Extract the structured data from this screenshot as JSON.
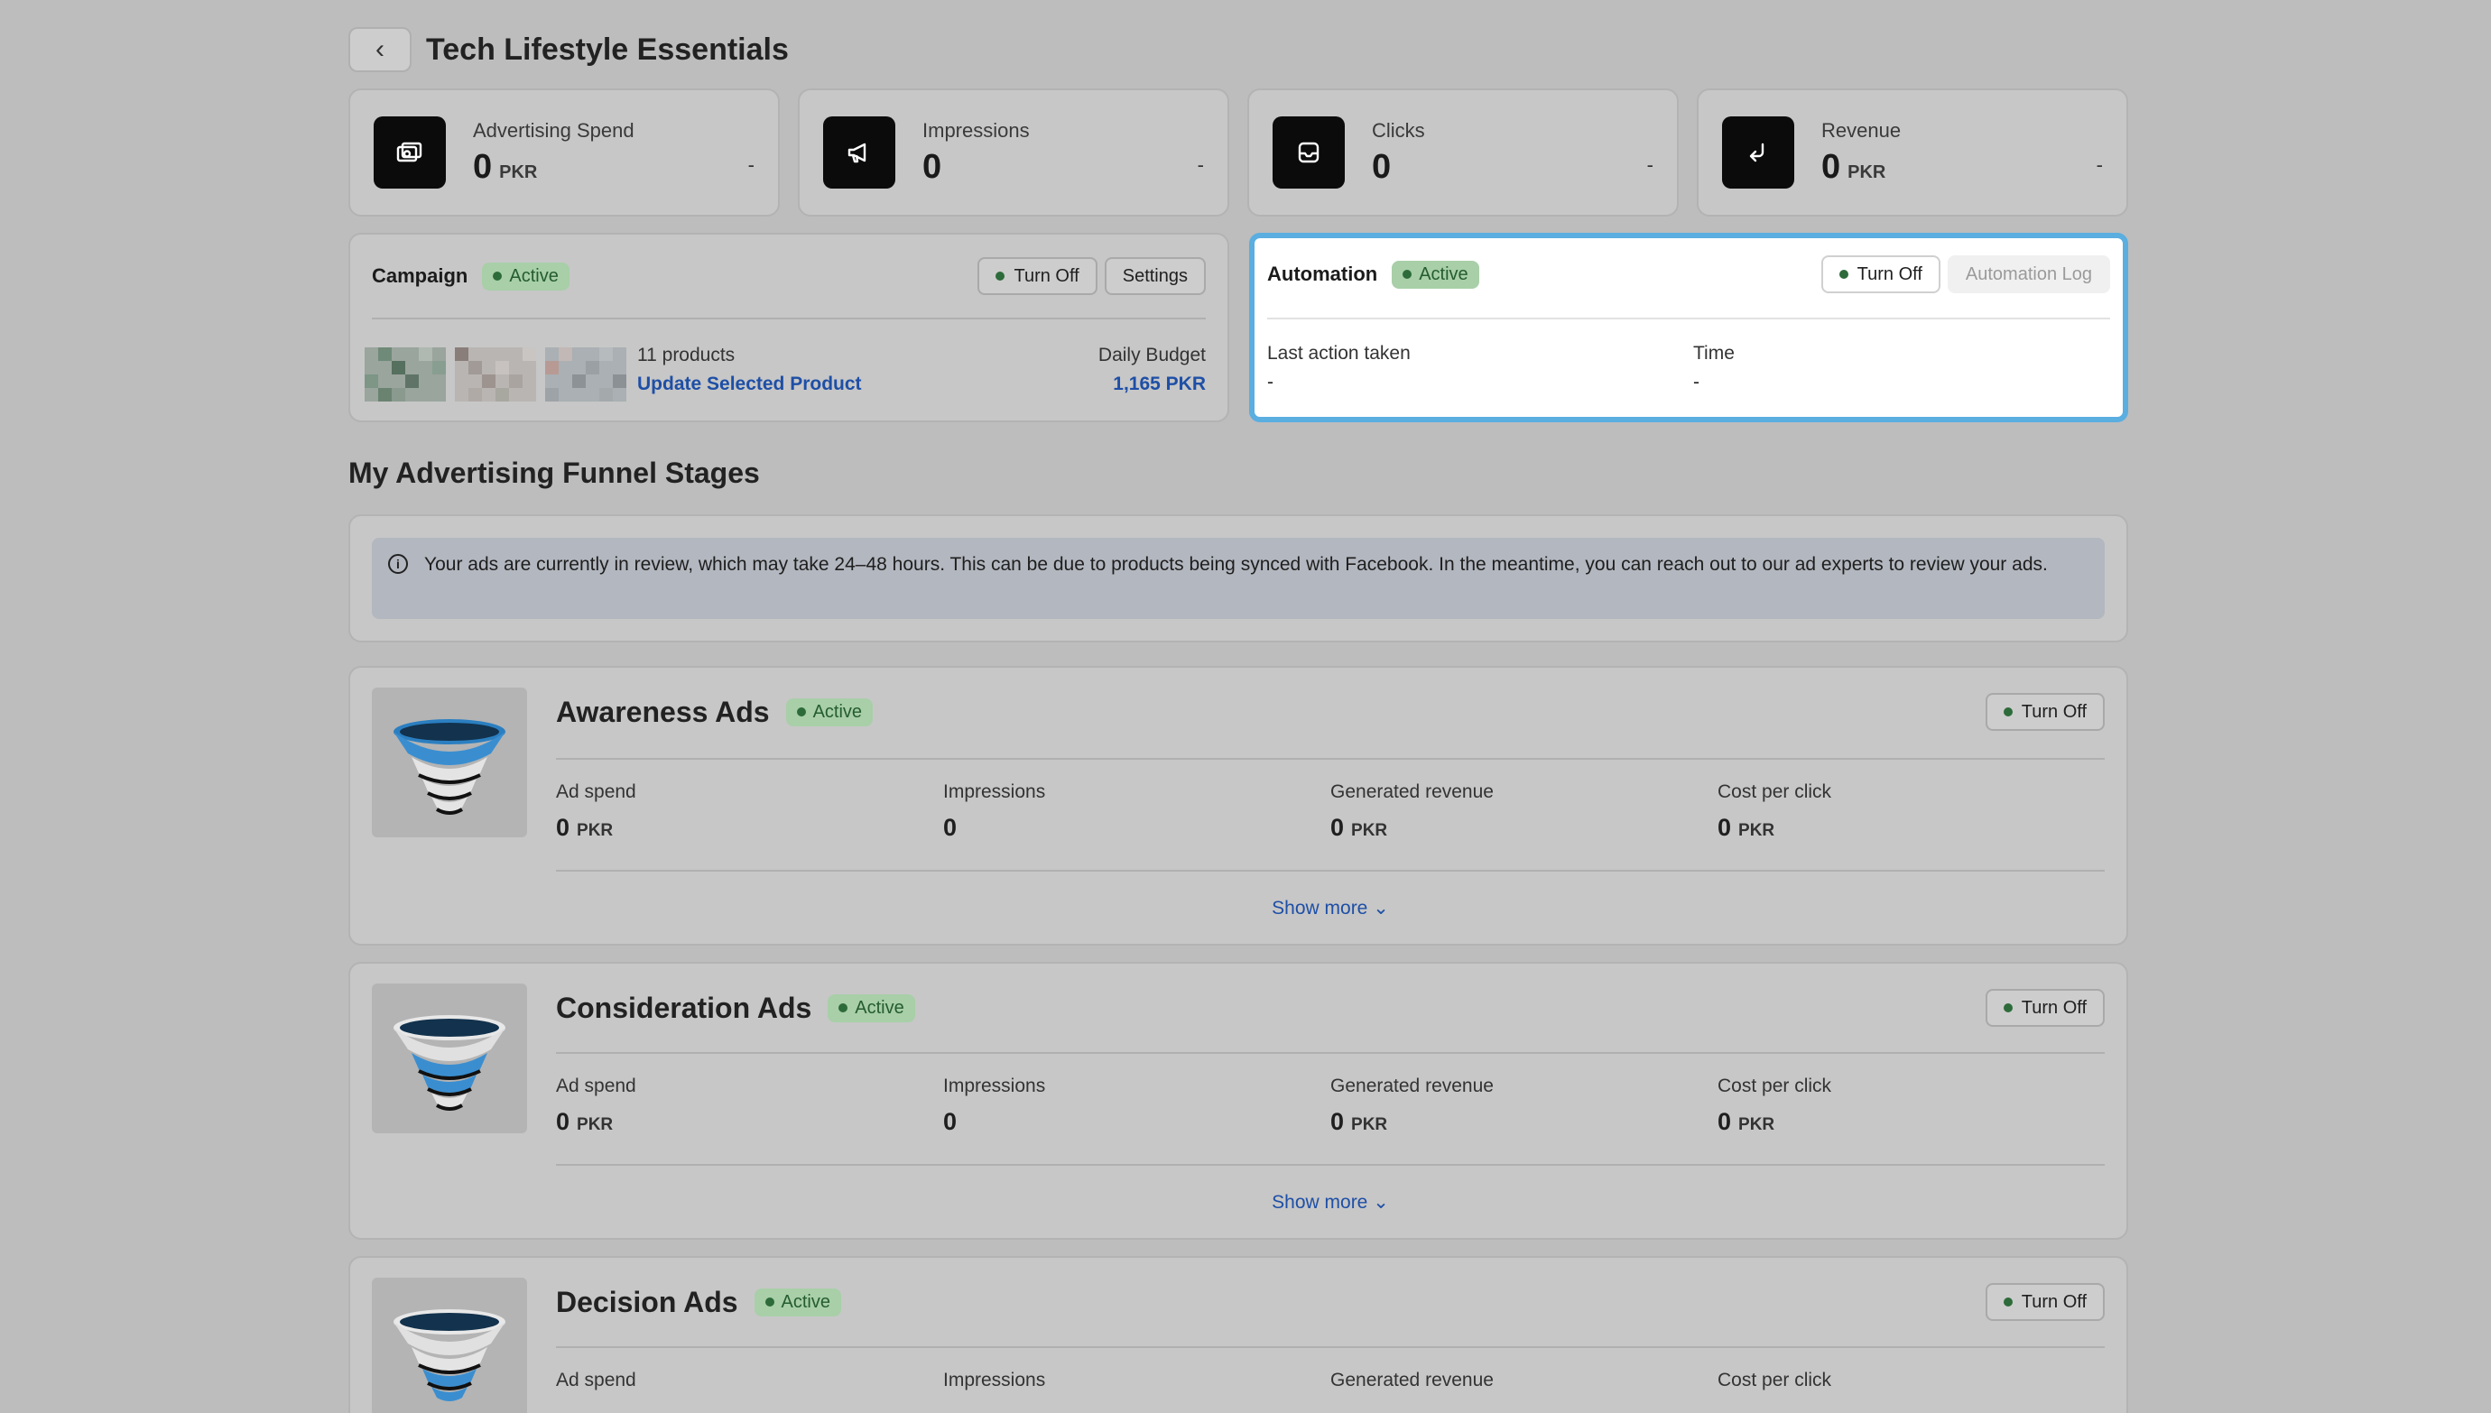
{
  "header": {
    "back_icon": "chevron-left-icon",
    "title": "Tech Lifestyle Essentials"
  },
  "stats": [
    {
      "label": "Advertising Spend",
      "value": "0",
      "unit": "PKR",
      "delta": "-",
      "icon": "money-stack-icon"
    },
    {
      "label": "Impressions",
      "value": "0",
      "unit": "",
      "delta": "-",
      "icon": "megaphone-icon"
    },
    {
      "label": "Clicks",
      "value": "0",
      "unit": "",
      "delta": "-",
      "icon": "inbox-icon"
    },
    {
      "label": "Revenue",
      "value": "0",
      "unit": "PKR",
      "delta": "-",
      "icon": "return-arrow-icon"
    }
  ],
  "campaign": {
    "title": "Campaign",
    "status": "Active",
    "turn_off": "Turn Off",
    "settings": "Settings",
    "products_count": "11 products",
    "update_link": "Update Selected Product",
    "budget_label": "Daily Budget",
    "budget_value": "1,165 PKR"
  },
  "automation": {
    "title": "Automation",
    "status": "Active",
    "turn_off": "Turn Off",
    "log": "Automation Log",
    "last_action_label": "Last action taken",
    "last_action_value": "-",
    "time_label": "Time",
    "time_value": "-"
  },
  "funnel_section": {
    "title": "My Advertising Funnel Stages",
    "info": "Your ads are currently in review, which may take 24–48 hours. This can be due to products being synced with Facebook. In the meantime, you can reach out to our ad experts to review your ads."
  },
  "funnels": [
    {
      "name": "Awareness Ads",
      "status": "Active",
      "turn_off": "Turn Off",
      "show_more": "Show more",
      "metrics": [
        {
          "label": "Ad spend",
          "value": "0",
          "unit": "PKR"
        },
        {
          "label": "Impressions",
          "value": "0",
          "unit": ""
        },
        {
          "label": "Generated revenue",
          "value": "0",
          "unit": "PKR"
        },
        {
          "label": "Cost per click",
          "value": "0",
          "unit": "PKR"
        }
      ]
    },
    {
      "name": "Consideration Ads",
      "status": "Active",
      "turn_off": "Turn Off",
      "show_more": "Show more",
      "metrics": [
        {
          "label": "Ad spend",
          "value": "0",
          "unit": "PKR"
        },
        {
          "label": "Impressions",
          "value": "0",
          "unit": ""
        },
        {
          "label": "Generated revenue",
          "value": "0",
          "unit": "PKR"
        },
        {
          "label": "Cost per click",
          "value": "0",
          "unit": "PKR"
        }
      ]
    },
    {
      "name": "Decision Ads",
      "status": "Active",
      "turn_off": "Turn Off",
      "metrics": [
        {
          "label": "Ad spend"
        },
        {
          "label": "Impressions"
        },
        {
          "label": "Generated revenue"
        },
        {
          "label": "Cost per click"
        }
      ]
    }
  ],
  "colors": {
    "accent_link": "#1e4fa6",
    "active_badge": "#a8cfa8",
    "focus_ring": "#5aaee0"
  }
}
